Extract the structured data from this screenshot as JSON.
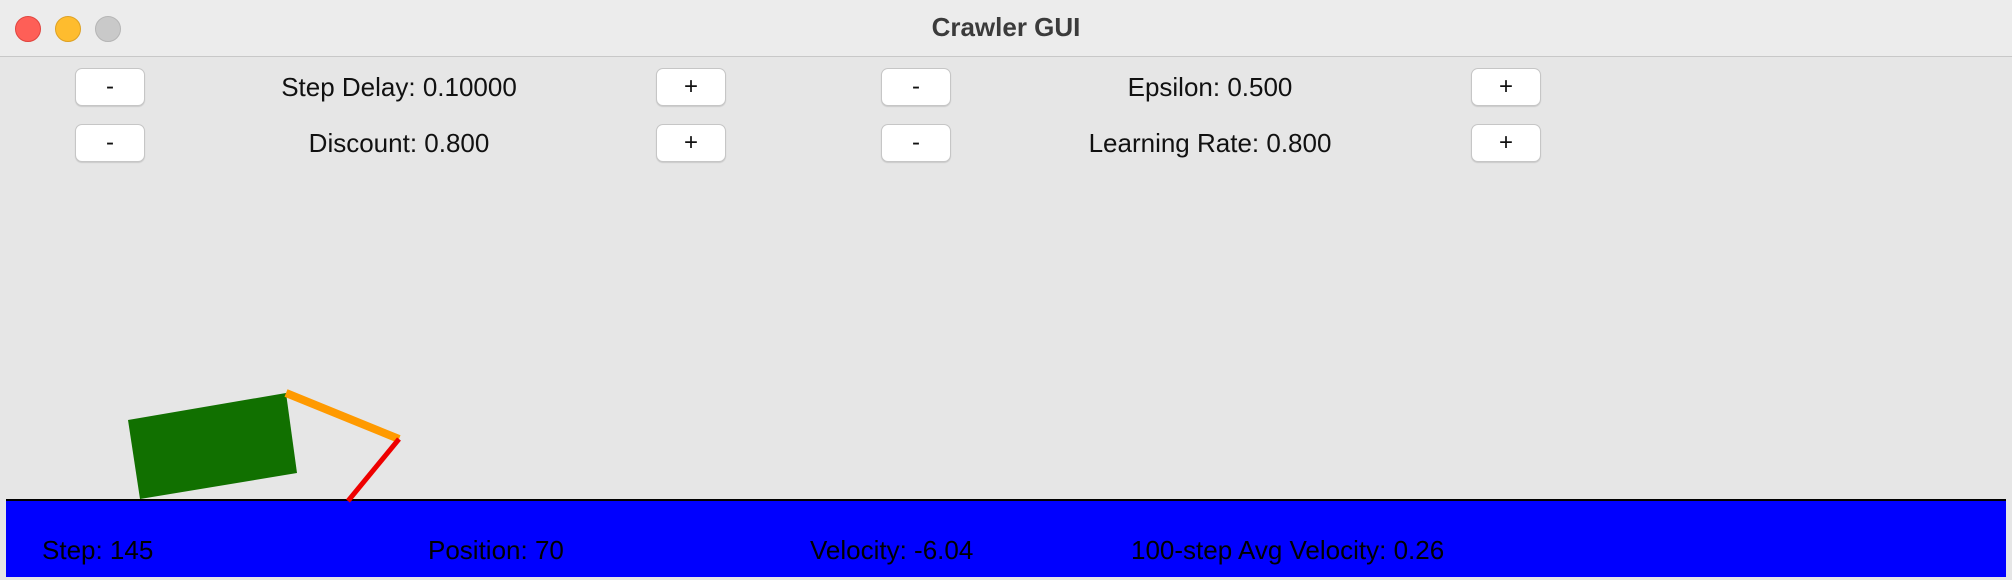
{
  "window": {
    "title": "Crawler GUI"
  },
  "controls": {
    "step_delay": {
      "label": "Step Delay: 0.10000",
      "dec": "-",
      "inc": "+"
    },
    "epsilon": {
      "label": "Epsilon: 0.500",
      "dec": "-",
      "inc": "+"
    },
    "discount": {
      "label": "Discount: 0.800",
      "dec": "-",
      "inc": "+"
    },
    "learning_rate": {
      "label": "Learning Rate: 0.800",
      "dec": "-",
      "inc": "+"
    }
  },
  "stats": {
    "step": "Step: 145",
    "position": "Position: 70",
    "velocity": "Velocity: -6.04",
    "avg_velocity": "100-step Avg Velocity: 0.26"
  },
  "colors": {
    "body": "#117000",
    "arm": "#ff9a00",
    "hand": "#ee0000",
    "ground": "#0000ff"
  }
}
